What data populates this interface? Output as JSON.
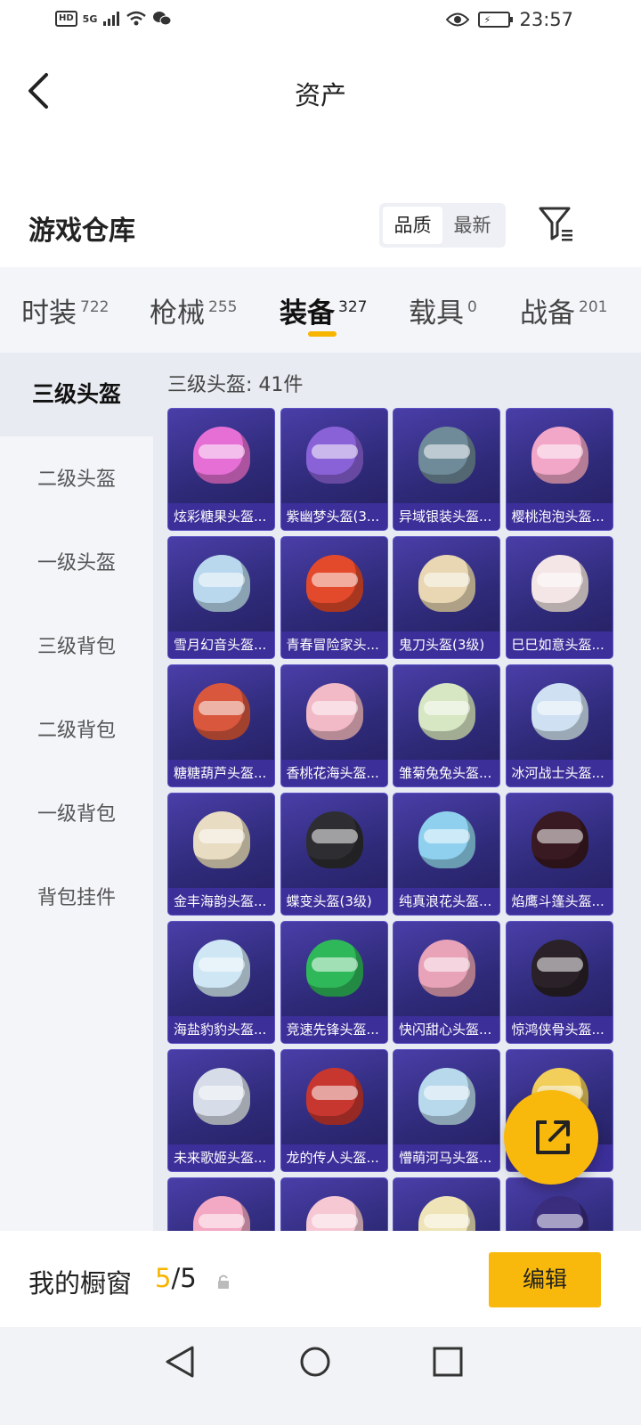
{
  "status_bar": {
    "network": "5G",
    "time": "23:57"
  },
  "header": {
    "title": "资产"
  },
  "warehouse": {
    "title": "游戏仓库",
    "sort_options": [
      "品质",
      "最新"
    ],
    "active_sort": "品质"
  },
  "tabs": [
    {
      "label": "时装",
      "count": "722"
    },
    {
      "label": "枪械",
      "count": "255"
    },
    {
      "label": "装备",
      "count": "327",
      "active": true
    },
    {
      "label": "载具",
      "count": "0"
    },
    {
      "label": "战备",
      "count": "201"
    }
  ],
  "sidebar": {
    "items": [
      "三级头盔",
      "二级头盔",
      "一级头盔",
      "三级背包",
      "二级背包",
      "一级背包",
      "背包挂件"
    ],
    "active": "三级头盔"
  },
  "content": {
    "count_text": "三级头盔: 41件",
    "items": [
      {
        "name": "炫彩糖果头盔...",
        "color": "#e66fd6"
      },
      {
        "name": "紫幽梦头盔(3...",
        "color": "#8a62d8"
      },
      {
        "name": "异域银装头盔...",
        "color": "#6f8a99"
      },
      {
        "name": "樱桃泡泡头盔...",
        "color": "#f2a6c8"
      },
      {
        "name": "雪月幻音头盔...",
        "color": "#b9d8ee"
      },
      {
        "name": "青春冒险家头...",
        "color": "#e24a2b"
      },
      {
        "name": "鬼刀头盔(3级)",
        "color": "#e8d7b2"
      },
      {
        "name": "巳巳如意头盔...",
        "color": "#f4e6e6"
      },
      {
        "name": "糖糖葫芦头盔...",
        "color": "#d9573d"
      },
      {
        "name": "香桃花海头盔...",
        "color": "#f2b9c6"
      },
      {
        "name": "雏菊兔兔头盔...",
        "color": "#d7e6c3"
      },
      {
        "name": "冰河战士头盔...",
        "color": "#cfe0f2"
      },
      {
        "name": "金丰海韵头盔...",
        "color": "#e8dcc2"
      },
      {
        "name": "蝶变头盔(3级)",
        "color": "#2e2e32"
      },
      {
        "name": "纯真浪花头盔...",
        "color": "#8ed0ee"
      },
      {
        "name": "焰鹰斗篷头盔...",
        "color": "#3a1a22"
      },
      {
        "name": "海盐豹豹头盔...",
        "color": "#cfe6f4"
      },
      {
        "name": "竞速先锋头盔...",
        "color": "#2fb85a"
      },
      {
        "name": "快闪甜心头盔...",
        "color": "#e8a3b9"
      },
      {
        "name": "惊鸿侠骨头盔...",
        "color": "#2a2228"
      },
      {
        "name": "未来歌姬头盔...",
        "color": "#d6dde8"
      },
      {
        "name": "龙的传人头盔...",
        "color": "#c8372f"
      },
      {
        "name": "懵萌河马头盔...",
        "color": "#b8d9ec"
      },
      {
        "name": "...",
        "color": "#f2cf5a"
      },
      {
        "name": "",
        "color": "#f3a9c4"
      },
      {
        "name": "",
        "color": "#f6c8d4"
      },
      {
        "name": "",
        "color": "#efe4b7"
      },
      {
        "name": "",
        "color": "#3b2d7e"
      }
    ]
  },
  "bottom_bar": {
    "label": "我的橱窗",
    "count_current": "5",
    "count_separator": "/",
    "count_total": "5",
    "edit_label": "编辑"
  }
}
